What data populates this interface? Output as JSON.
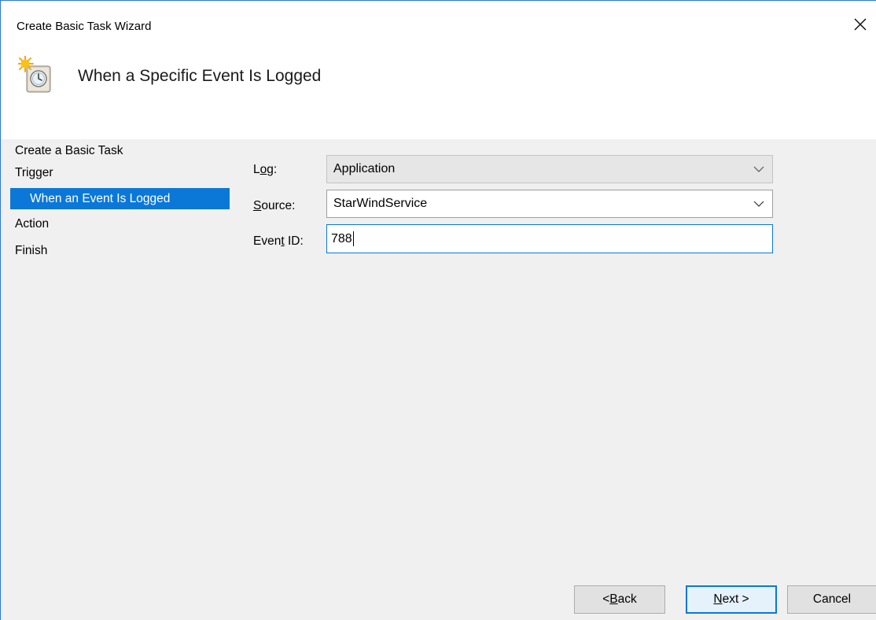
{
  "window": {
    "title": "Create Basic Task Wizard",
    "close_label": "×"
  },
  "header": {
    "title": "When a Specific Event Is Logged",
    "icon": "task-scheduler-clock-icon"
  },
  "sidebar": {
    "items": [
      {
        "label": "Create a Basic Task",
        "selected": false
      },
      {
        "label": "Trigger",
        "selected": false
      },
      {
        "label": "When an Event Is Logged",
        "selected": true
      },
      {
        "label": "Action",
        "selected": false
      },
      {
        "label": "Finish",
        "selected": false
      }
    ]
  },
  "form": {
    "log": {
      "label_pre": "L",
      "label_u": "o",
      "label_post": "g:",
      "value": "Application"
    },
    "source": {
      "label_pre": "",
      "label_u": "S",
      "label_post": "ource:",
      "value": "StarWindService"
    },
    "event_id": {
      "label_pre": "Even",
      "label_u": "t",
      "label_post": " ID:",
      "value": "788"
    }
  },
  "buttons": {
    "back": {
      "pre": "< ",
      "u": "B",
      "post": "ack"
    },
    "next": {
      "pre": "",
      "u": "N",
      "post": "ext >"
    },
    "cancel": {
      "label": "Cancel"
    }
  },
  "colors": {
    "accent": "#0b78d7",
    "window_border": "#2b79d8"
  }
}
